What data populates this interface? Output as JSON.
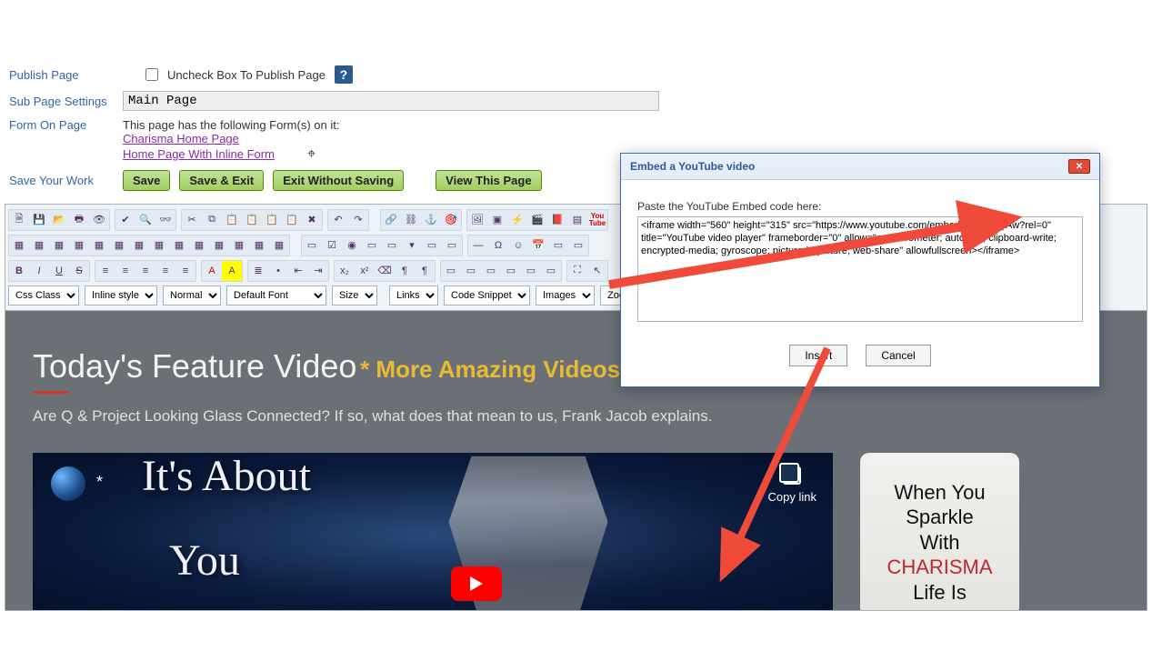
{
  "meta": {
    "publish_label": "Publish Page",
    "uncheck_label": "Uncheck Box To Publish Page",
    "help_glyph": "?",
    "subpage_label": "Sub Page Settings",
    "subpage_value": "Main Page",
    "form_label": "Form On Page",
    "form_intro": "This page has the following Form(s) on it:",
    "form_links": [
      "Charisma Home Page",
      "Home Page With Inline Form"
    ],
    "save_label": "Save Your Work"
  },
  "buttons": {
    "save": "Save",
    "save_exit": "Save & Exit",
    "exit_no_save": "Exit Without Saving",
    "view_page": "View This Page"
  },
  "toolbar": {
    "css_class": "Css Class",
    "inline_style": "Inline style",
    "paragraph": "Normal",
    "font": "Default Font",
    "size": "Size",
    "links": "Links",
    "snippet": "Code Snippet",
    "images": "Images",
    "zoom": "Zoom",
    "youtube_text": "You Tube"
  },
  "content": {
    "heading": "Today's Feature Video",
    "subheading": "* More Amazing Videos Below",
    "description": "Are Q & Project Looking Glass Connected? If so, what does that mean to us, Frank Jacob explains.",
    "video_overlay_line1": "It's About",
    "video_overlay_line2": "You",
    "copy_link": "Copy link",
    "star": "*"
  },
  "sidebar": {
    "line1": "When You",
    "line2": "Sparkle",
    "line3": "With",
    "highlight": "CHARISMA",
    "line5": "Life Is"
  },
  "dialog": {
    "title": "Embed a YouTube video",
    "hint": "Paste the YouTube Embed code here:",
    "code": "<iframe width=\"560\" height=\"315\" src=\"https://www.youtube.com/embed/yUj9rbZ_lAw?rel=0\" title=\"YouTube video player\" frameborder=\"0\" allow=\"accelerometer; autoplay; clipboard-write; encrypted-media; gyroscope; picture-in-picture; web-share\" allowfullscreen></iframe>",
    "insert": "Insert",
    "cancel": "Cancel"
  }
}
